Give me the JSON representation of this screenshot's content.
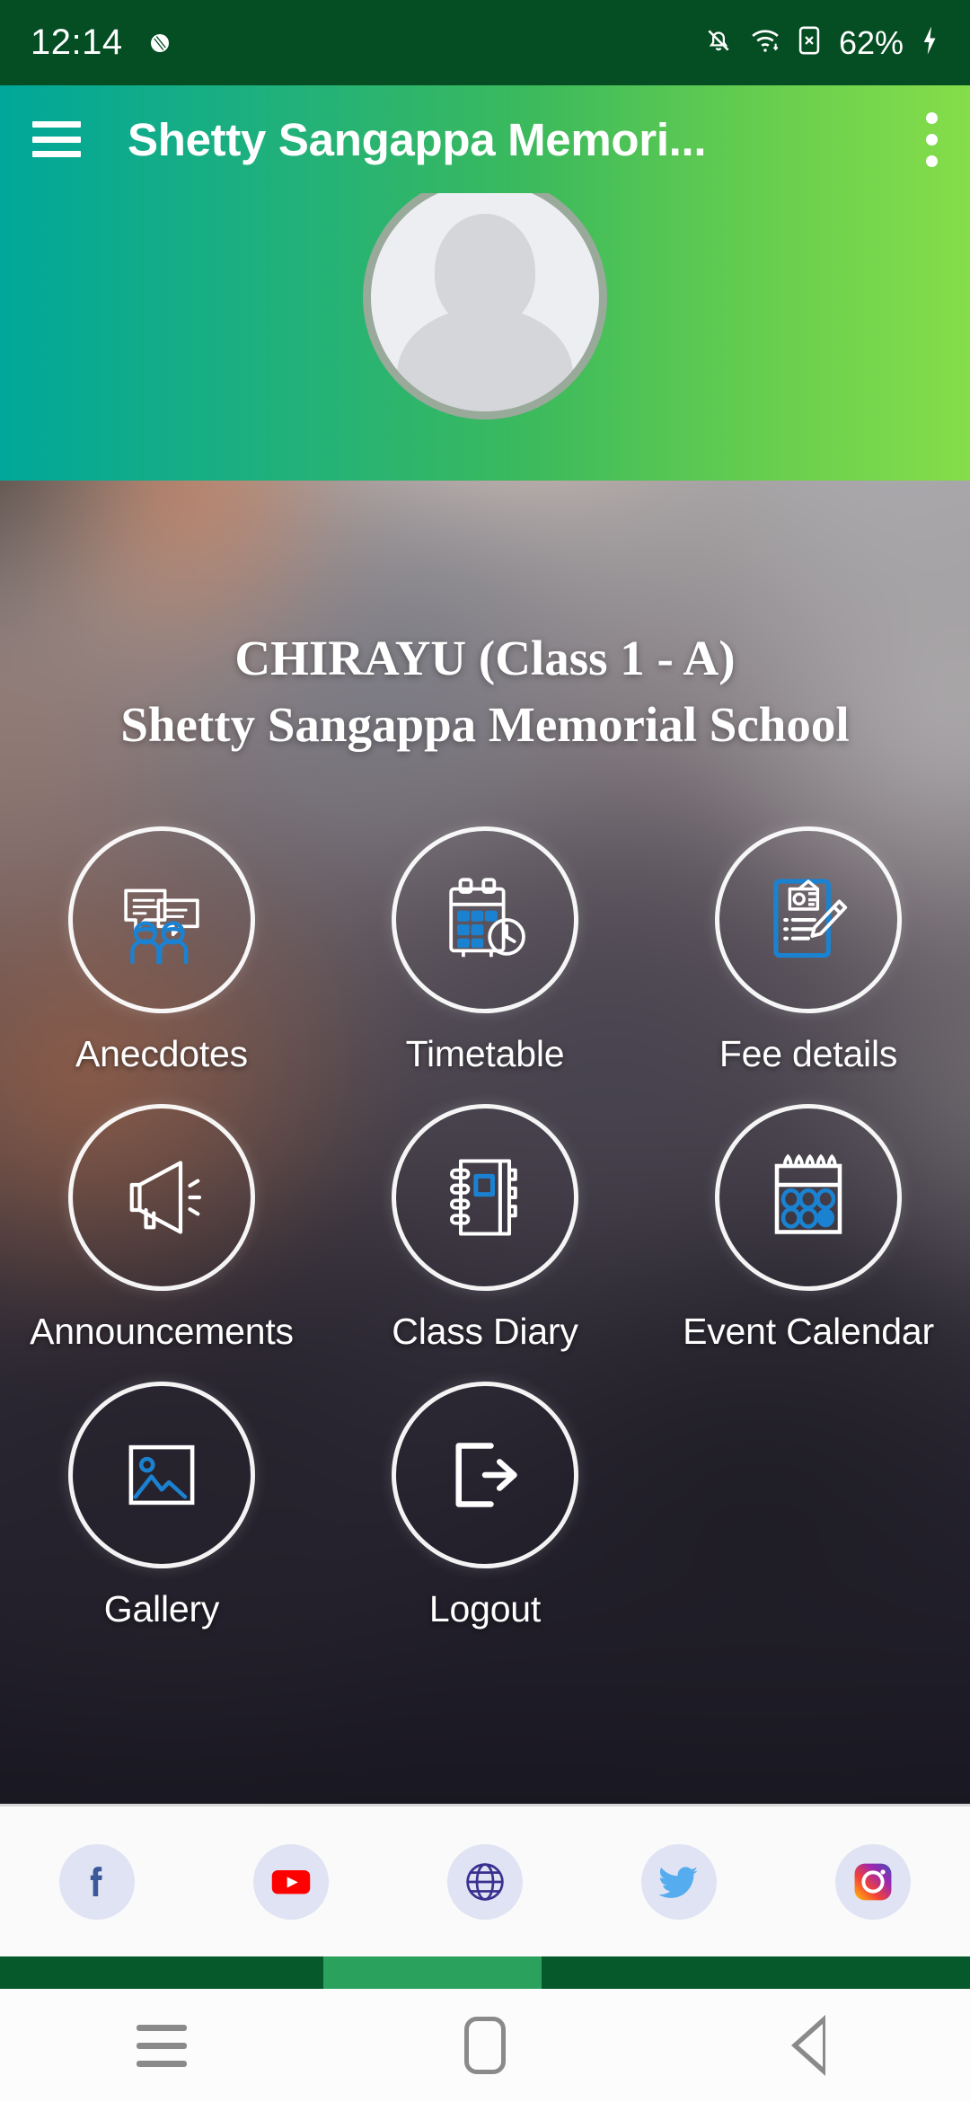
{
  "status_bar": {
    "time": "12:14",
    "battery_text": "62%",
    "icons": [
      "notification-dot-icon",
      "bell-muted-icon",
      "wifi-icon",
      "sim-x-icon",
      "battery-charging-icon"
    ]
  },
  "toolbar": {
    "menu_icon": "hamburger-menu-icon",
    "title": "Shetty Sangappa Memori...",
    "overflow_icon": "overflow-menu-icon"
  },
  "profile": {
    "avatar_icon": "default-person-avatar",
    "student_line": "CHIRAYU (Class 1 - A)",
    "school_line": "Shetty Sangappa Memorial School"
  },
  "grid": {
    "items": [
      {
        "label": "Anecdotes",
        "icon": "anecdotes-icon"
      },
      {
        "label": "Timetable",
        "icon": "timetable-icon"
      },
      {
        "label": "Fee details",
        "icon": "fee-details-icon"
      },
      {
        "label": "Announcements",
        "icon": "announcements-icon"
      },
      {
        "label": "Class Diary",
        "icon": "class-diary-icon"
      },
      {
        "label": "Event Calendar",
        "icon": "event-calendar-icon"
      },
      {
        "label": "Gallery",
        "icon": "gallery-icon"
      },
      {
        "label": "Logout",
        "icon": "logout-icon"
      }
    ]
  },
  "social_bar": {
    "items": [
      {
        "name": "facebook",
        "icon": "facebook-icon"
      },
      {
        "name": "youtube",
        "icon": "youtube-icon"
      },
      {
        "name": "website",
        "icon": "globe-icon"
      },
      {
        "name": "twitter",
        "icon": "twitter-icon"
      },
      {
        "name": "instagram",
        "icon": "instagram-icon"
      }
    ]
  },
  "indicator": {
    "segments": [
      "dark",
      "light",
      "dark"
    ]
  },
  "navigation_bar": {
    "recents_icon": "recents-icon",
    "home_icon": "home-icon",
    "back_icon": "back-icon"
  },
  "colors": {
    "status_bar_bg": "#054d22",
    "toolbar_gradient_start": "#00a79a",
    "toolbar_gradient_end": "#85dd4a",
    "icon_accent_blue": "#1b82d2",
    "indicator_dark": "#06592b",
    "indicator_light": "#2aa15d"
  }
}
